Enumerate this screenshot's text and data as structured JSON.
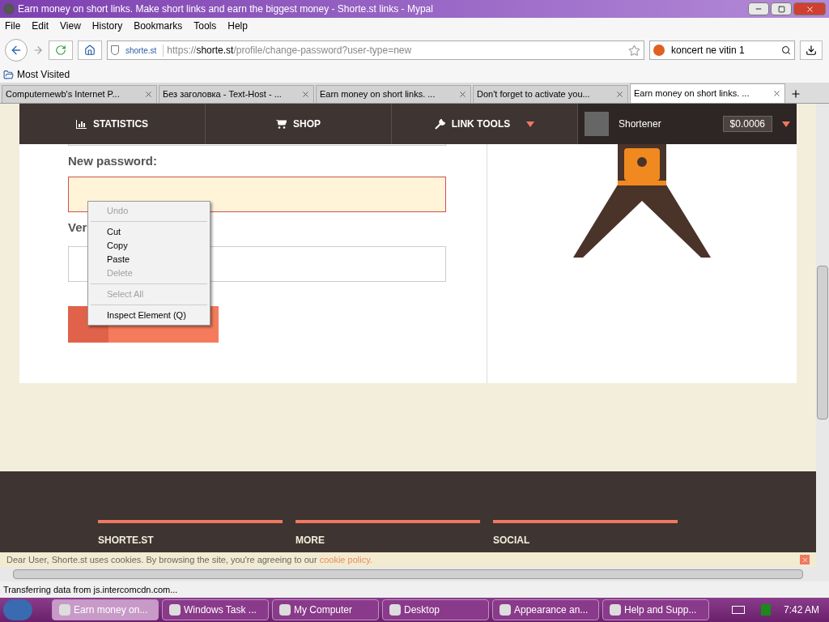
{
  "window": {
    "title": "Earn money on short links. Make short links and earn the biggest money - Shorte.st links - Mypal"
  },
  "menu_bar": [
    "File",
    "Edit",
    "View",
    "History",
    "Bookmarks",
    "Tools",
    "Help"
  ],
  "nav_bar": {
    "site_label": "shorte.st",
    "url_prefix": "https://",
    "url_host": "shorte.st",
    "url_path": "/profile/change-password?user-type=new",
    "search_value": "koncert ne vitin 1"
  },
  "bookmarks": [
    "Most Visited"
  ],
  "tabs": [
    {
      "label": "Computernewb's Internet P...",
      "selected": false
    },
    {
      "label": "Без заголовка - Text-Host - ...",
      "selected": false
    },
    {
      "label": "Earn money on short links. ...",
      "selected": false
    },
    {
      "label": "Don't forget to activate you...",
      "selected": false
    },
    {
      "label": "Earn money on short links. ...",
      "selected": true
    }
  ],
  "site_nav": {
    "items": [
      {
        "label": "STATISTICS",
        "kind": "stats",
        "dropdown": false
      },
      {
        "label": "SHOP",
        "kind": "cart",
        "dropdown": false
      },
      {
        "label": "LINK TOOLS",
        "kind": "wrench",
        "dropdown": true
      }
    ],
    "user": "Shortener",
    "balance": "$0.0006"
  },
  "form": {
    "new_password_label": "New password:",
    "verify_label": "Ver"
  },
  "context_menu": [
    [
      {
        "label": "Undo",
        "disabled": true
      }
    ],
    [
      {
        "label": "Cut",
        "disabled": false
      },
      {
        "label": "Copy",
        "disabled": false
      },
      {
        "label": "Paste",
        "disabled": false
      },
      {
        "label": "Delete",
        "disabled": true
      }
    ],
    [
      {
        "label": "Select All",
        "disabled": true
      }
    ],
    [
      {
        "label": "Inspect Element (Q)",
        "disabled": false
      }
    ]
  ],
  "footer": {
    "headings": [
      "SHORTE.ST",
      "MORE",
      "SOCIAL"
    ]
  },
  "cookie_bar": {
    "text": "Dear User, Shorte.st uses cookies. By browsing the site, you're agreeing to our",
    "link": "cookie policy."
  },
  "status_bar": "Transferring data from js.intercomcdn.com...",
  "taskbar": {
    "items": [
      {
        "label": "Earn money on...",
        "selected": true
      },
      {
        "label": "Windows Task ...",
        "selected": false
      },
      {
        "label": "My Computer",
        "selected": false
      },
      {
        "label": "Desktop",
        "selected": false
      },
      {
        "label": "Appearance an...",
        "selected": false
      },
      {
        "label": "Help and Supp...",
        "selected": false
      }
    ],
    "clock": "7:42 AM"
  }
}
